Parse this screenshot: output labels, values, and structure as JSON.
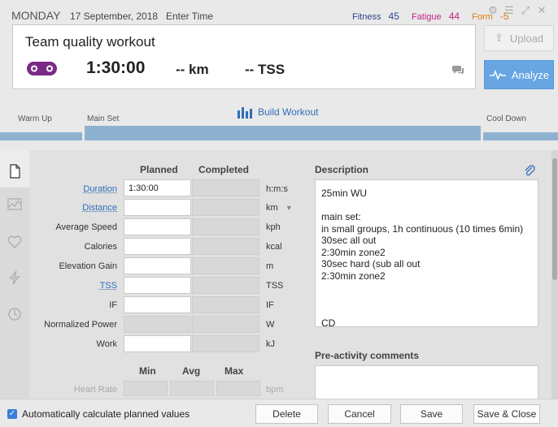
{
  "header": {
    "day": "MONDAY",
    "date": "17 September, 2018",
    "enter_time": "Enter Time",
    "fitness_label": "Fitness",
    "fitness_value": "45",
    "fatigue_label": "Fatigue",
    "fatigue_value": "44",
    "form_label": "Form",
    "form_value": "-5"
  },
  "workout": {
    "title": "Team quality workout",
    "sport_icon": "bike-icon",
    "duration": "1:30:00",
    "distance": "-- km",
    "tss": "-- TSS"
  },
  "actions": {
    "upload": "Upload",
    "analyze": "Analyze"
  },
  "builder": {
    "build_label": "Build Workout",
    "warm_up": "Warm Up",
    "main_set": "Main Set",
    "cool_down": "Cool Down"
  },
  "table": {
    "planned_header": "Planned",
    "completed_header": "Completed",
    "rows": [
      {
        "label": "Duration",
        "planned": "1:30:00",
        "unit": "h:m:s"
      },
      {
        "label": "Distance",
        "planned": "",
        "unit": "km"
      },
      {
        "label": "Average Speed",
        "planned": "",
        "unit": "kph"
      },
      {
        "label": "Calories",
        "planned": "",
        "unit": "kcal"
      },
      {
        "label": "Elevation Gain",
        "planned": "",
        "unit": "m"
      },
      {
        "label": "TSS",
        "planned": "",
        "unit": "TSS"
      },
      {
        "label": "IF",
        "planned": "",
        "unit": "IF"
      },
      {
        "label": "Normalized Power",
        "planned": "",
        "unit": "W"
      },
      {
        "label": "Work",
        "planned": "",
        "unit": "kJ"
      }
    ],
    "min_header": "Min",
    "avg_header": "Avg",
    "max_header": "Max",
    "hr_label": "Heart Rate",
    "hr_unit": "bpm"
  },
  "description": {
    "title": "Description",
    "text": "25min WU\n\nmain set:\nin small groups, 1h continuous (10 times 6min)\n30sec all out\n2:30min zone2\n30sec hard (sub all out\n2:30min zone2\n\n\n\nCD",
    "pre_title": "Pre-activity comments"
  },
  "footer": {
    "auto_calc": "Automatically calculate planned values",
    "delete": "Delete",
    "cancel": "Cancel",
    "save": "Save",
    "save_close": "Save & Close"
  },
  "colors": {
    "accent": "#67a5e3",
    "bar": "#8fb1d0",
    "link": "#2f6fb6",
    "bike": "#7b2a86"
  }
}
